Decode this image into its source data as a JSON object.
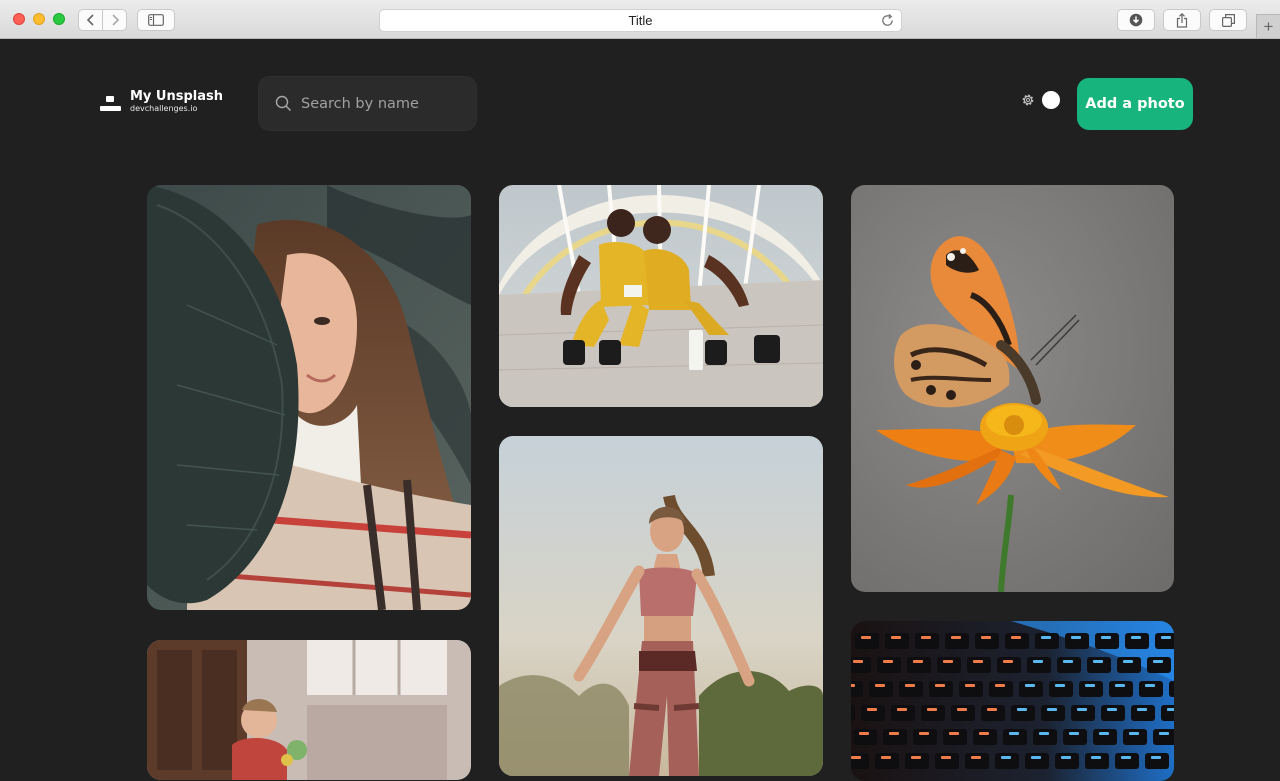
{
  "browser": {
    "title": "Title",
    "new_tab": "+"
  },
  "header": {
    "logo_title": "My Unsplash",
    "logo_subtitle": "devchallenges.io",
    "search_placeholder": "Search by name",
    "add_button_label": "Add a photo",
    "accent_color": "#18b47d"
  },
  "gallery": {
    "photos": [
      {
        "subject": "woman-with-leaf"
      },
      {
        "subject": "two-women-sitting"
      },
      {
        "subject": "butterfly-on-flower"
      },
      {
        "subject": "child-in-room"
      },
      {
        "subject": "woman-exercising"
      },
      {
        "subject": "keyboard-closeup"
      }
    ]
  }
}
